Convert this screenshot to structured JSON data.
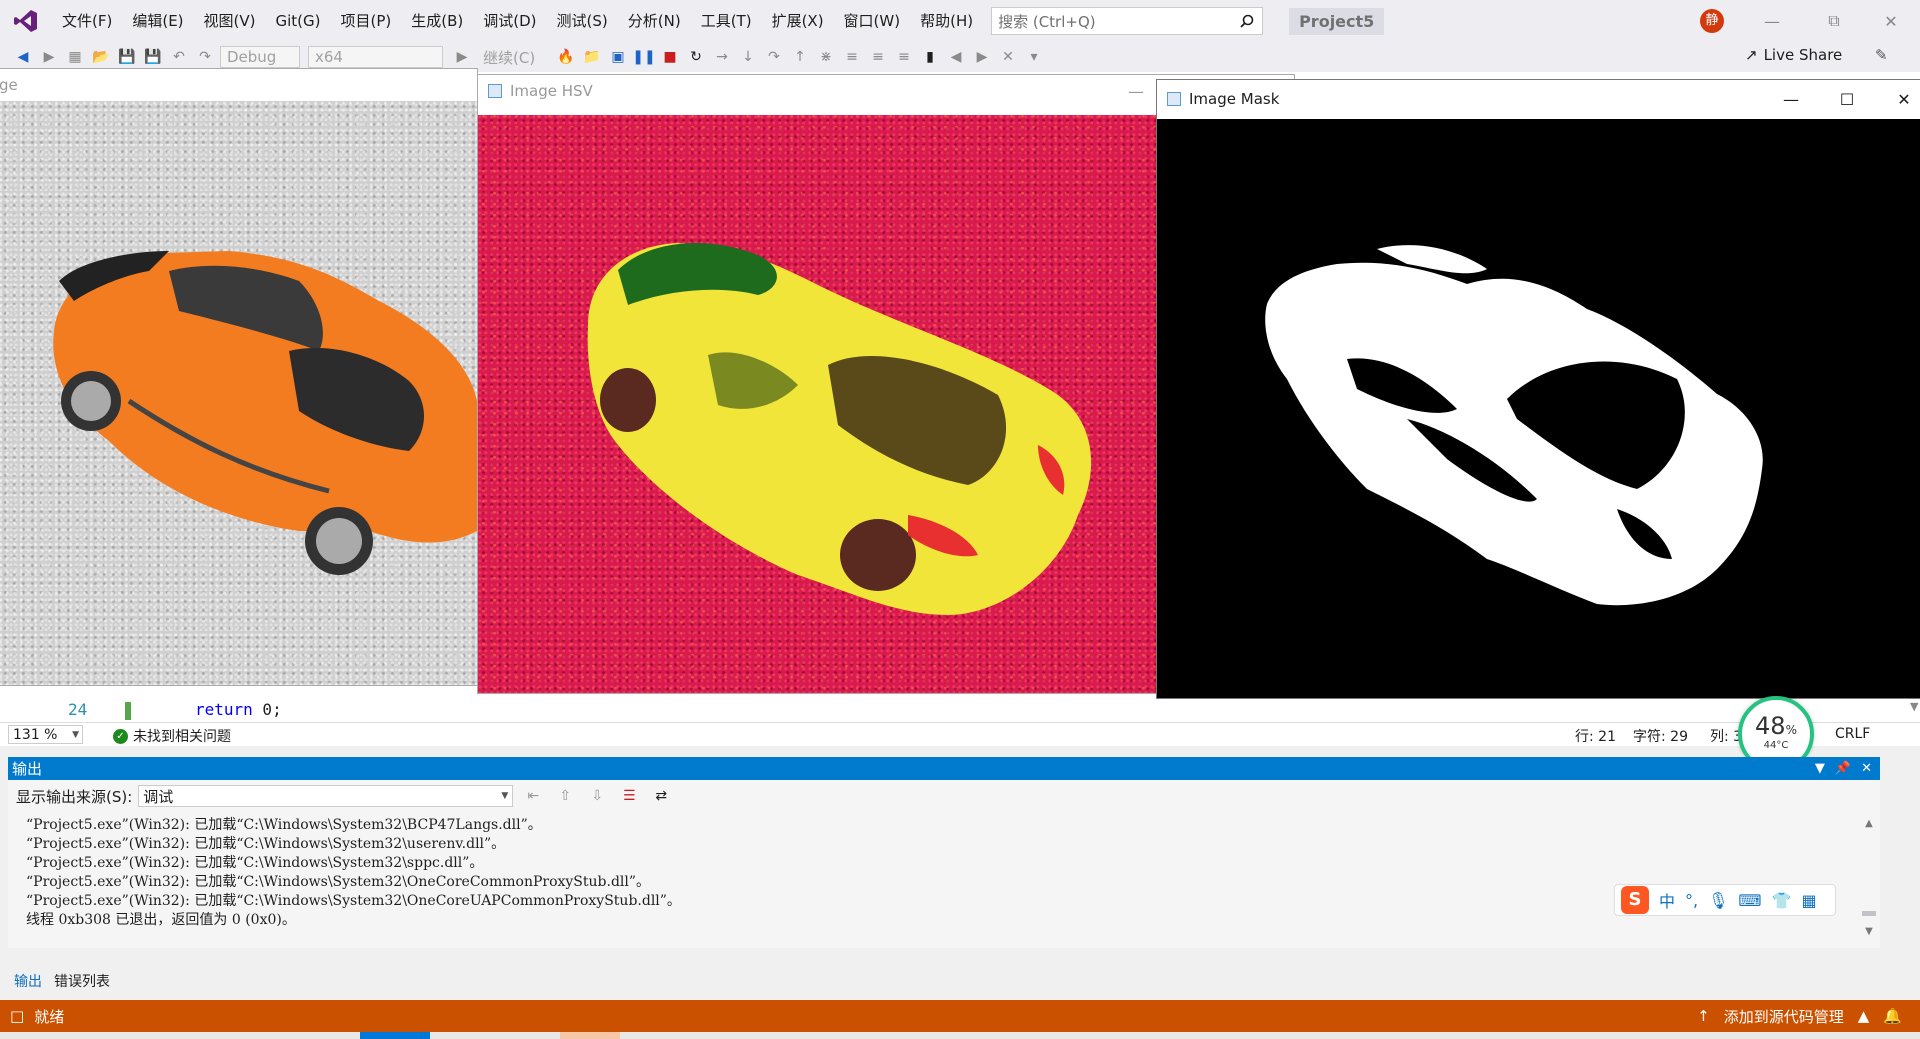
{
  "menubar": {
    "items": [
      "文件(F)",
      "编辑(E)",
      "视图(V)",
      "Git(G)",
      "项目(P)",
      "生成(B)",
      "调试(D)",
      "测试(S)",
      "分析(N)",
      "工具(T)",
      "扩展(X)",
      "窗口(W)",
      "帮助(H)"
    ],
    "search_placeholder": "搜索 (Ctrl+Q)",
    "project_name": "Project5",
    "user_initial": "静"
  },
  "toolbar": {
    "config": "Debug",
    "platform": "x64",
    "continue_label": "继续(C)",
    "live_share": "Live Share"
  },
  "windows": {
    "original_title_fragment": "ge",
    "hsv_title": "Image HSV",
    "mask_title": "Image Mask"
  },
  "editor": {
    "line_number": "24",
    "code_keyword": "return",
    "code_rest": " 0;",
    "zoom": "131 %",
    "issues": "未找到相关问题",
    "line": "行: 21",
    "char": "字符: 29",
    "col": "列: 3",
    "eol": "CRLF"
  },
  "gauge": {
    "value": "48",
    "unit": "%",
    "temp": "44°C"
  },
  "output": {
    "title": "输出",
    "source_label": "显示输出来源(S):",
    "source_value": "调试",
    "lines": [
      "“Project5.exe”(Win32): 已加载“C:\\Windows\\System32\\BCP47Langs.dll”。",
      "“Project5.exe”(Win32): 已加载“C:\\Windows\\System32\\userenv.dll”。",
      "“Project5.exe”(Win32): 已加载“C:\\Windows\\System32\\sppc.dll”。",
      "“Project5.exe”(Win32): 已加载“C:\\Windows\\System32\\OneCoreCommonProxyStub.dll”。",
      "“Project5.exe”(Win32): 已加载“C:\\Windows\\System32\\OneCoreUAPCommonProxyStub.dll”。",
      "线程 0xb308 已退出，返回值为 0 (0x0)。"
    ],
    "tabs": [
      "输出",
      "错误列表"
    ]
  },
  "ime": {
    "logo": "S",
    "mode": "中"
  },
  "statusbar": {
    "ready": "就绪",
    "source_control": "添加到源代码管理"
  },
  "colors": {
    "accent_blue": "#007acc",
    "status_orange": "#ca5100",
    "hsv_red": "#d81b4a",
    "car_orange": "#f47c20",
    "car_yellow": "#f2e53a"
  }
}
